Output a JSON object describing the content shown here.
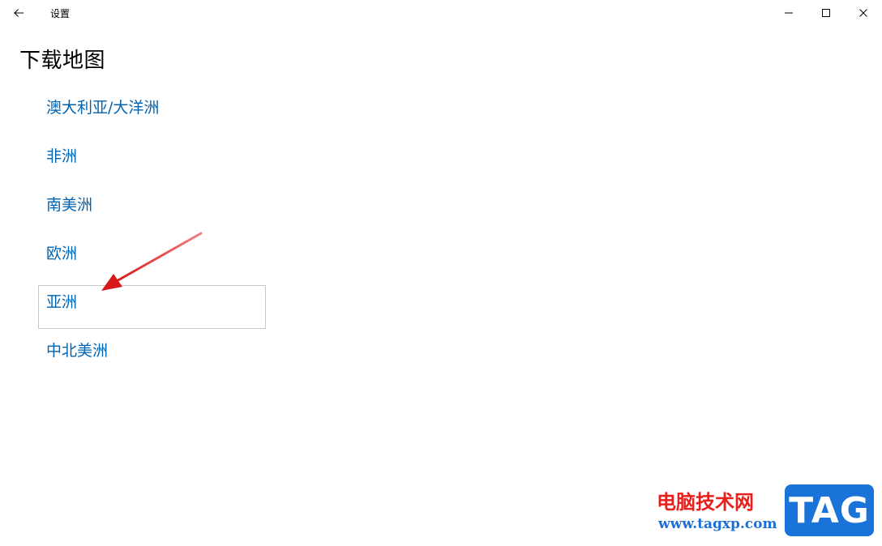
{
  "window": {
    "title": "设置",
    "icons": {
      "back": "back-arrow-icon",
      "minimize": "minimize-icon",
      "maximize": "maximize-icon",
      "close": "close-icon"
    }
  },
  "page": {
    "title": "下载地图"
  },
  "regions": [
    {
      "label": "澳大利亚/大洋洲"
    },
    {
      "label": "非洲"
    },
    {
      "label": "南美洲"
    },
    {
      "label": "欧洲"
    },
    {
      "label": "亚洲",
      "focused": true
    },
    {
      "label": "中北美洲"
    }
  ],
  "colors": {
    "link": "#0063b1",
    "annotation_arrow": "#e02020",
    "watermark_red": "#e8201b",
    "watermark_blue": "#1a73d8"
  },
  "watermark": {
    "site_name": "电脑技术网",
    "url": "www.tagxp.com",
    "logo_text": "TAG"
  }
}
